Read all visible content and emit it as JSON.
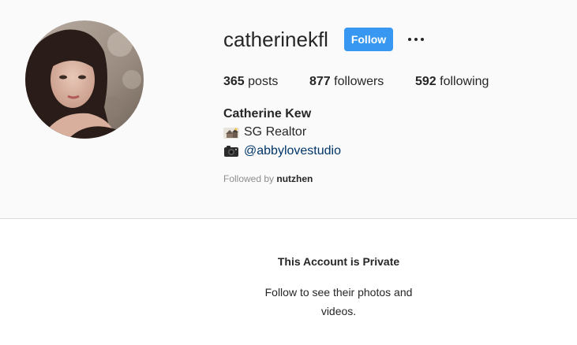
{
  "profile": {
    "username": "catherinekfl",
    "follow_label": "Follow",
    "options_icon": "more-options-icon",
    "stats": {
      "posts_count": "365",
      "posts_label": "posts",
      "followers_count": "877",
      "followers_label": "followers",
      "following_count": "592",
      "following_label": "following"
    },
    "full_name": "Catherine Kew",
    "bio": {
      "line1_icon": "house-emoji-icon",
      "line1_text": "SG Realtor",
      "line2_icon": "camera-emoji-icon",
      "line2_link": "@abbylovestudio"
    },
    "followed_by_prefix": "Followed by",
    "followed_by_name": "nutzhen"
  },
  "private_notice": {
    "title": "This Account is Private",
    "subtitle": "Follow to see their photos and videos."
  },
  "colors": {
    "follow_button": "#3897f0",
    "header_bg": "#fafafa",
    "link": "#003569",
    "muted": "#8e8e8e"
  }
}
